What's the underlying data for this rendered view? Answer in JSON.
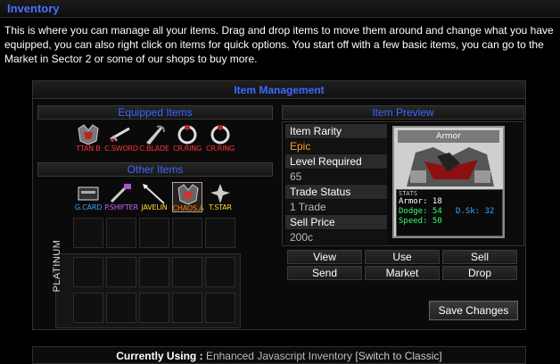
{
  "page": {
    "title": "Inventory",
    "intro": "This is where you can manage all your items. Drag and drop items to move them around and change what you have equipped, you can also right click on items for quick options. You start off with a few basic items, you can go to the Market in Sector 2 or some of our shops to buy more."
  },
  "panel": {
    "title": "Item Management",
    "equipped_heading": "Equipped Items",
    "other_heading": "Other Items",
    "preview_heading": "Item Preview",
    "platinum_label": "PLATINUM",
    "equipped_items": [
      {
        "label": "TTAN.B",
        "color": "#ff3333",
        "icon": "armor-icon"
      },
      {
        "label": "C.SWORD",
        "color": "#ff3333",
        "icon": "sword-icon"
      },
      {
        "label": "C.BLADE",
        "color": "#ff3333",
        "icon": "blade-icon"
      },
      {
        "label": "CR.RING",
        "color": "#ff3333",
        "icon": "ring-icon"
      },
      {
        "label": "CR.RING",
        "color": "#ff3333",
        "icon": "ring-icon"
      }
    ],
    "other_items": [
      {
        "label": "G.CARD",
        "color": "#33aaff",
        "icon": "card-icon"
      },
      {
        "label": "P.SHIFTER",
        "color": "#cc66ff",
        "icon": "shifter-icon"
      },
      {
        "label": "JAVELIN",
        "color": "#ffdd33",
        "icon": "javelin-icon"
      },
      {
        "label": "CHAOS.A",
        "color": "#ff8800",
        "icon": "chaos-armor-icon"
      },
      {
        "label": "T.STAR",
        "color": "#ffdd33",
        "icon": "star-icon"
      }
    ]
  },
  "preview": {
    "rarity_label": "Item Rarity",
    "rarity_value": "Epic",
    "level_label": "Level Required",
    "level_value": "65",
    "trade_label": "Trade Status",
    "trade_value": "1 Trade",
    "price_label": "Sell Price",
    "price_value": "200c",
    "card_title": "Armor",
    "stats_caption": "STATS",
    "stats": {
      "armor": "Armor: 18",
      "dodge": "Dodge: 54",
      "dsk": "D.Sk: 32",
      "speed": "Speed: 50"
    }
  },
  "actions": {
    "view": "View",
    "use": "Use",
    "sell": "Sell",
    "send": "Send",
    "market": "Market",
    "drop": "Drop"
  },
  "save_label": "Save Changes",
  "footer": {
    "key": "Currently Using :",
    "value": "Enhanced Javascript Inventory",
    "link": "[Switch to Classic]"
  },
  "colors": {
    "accent": "#3a6bff",
    "epic": "#ff9933",
    "stat_dodge": "#33ff66",
    "stat_speed": "#33ff66",
    "stat_dsk": "#33aaff"
  }
}
